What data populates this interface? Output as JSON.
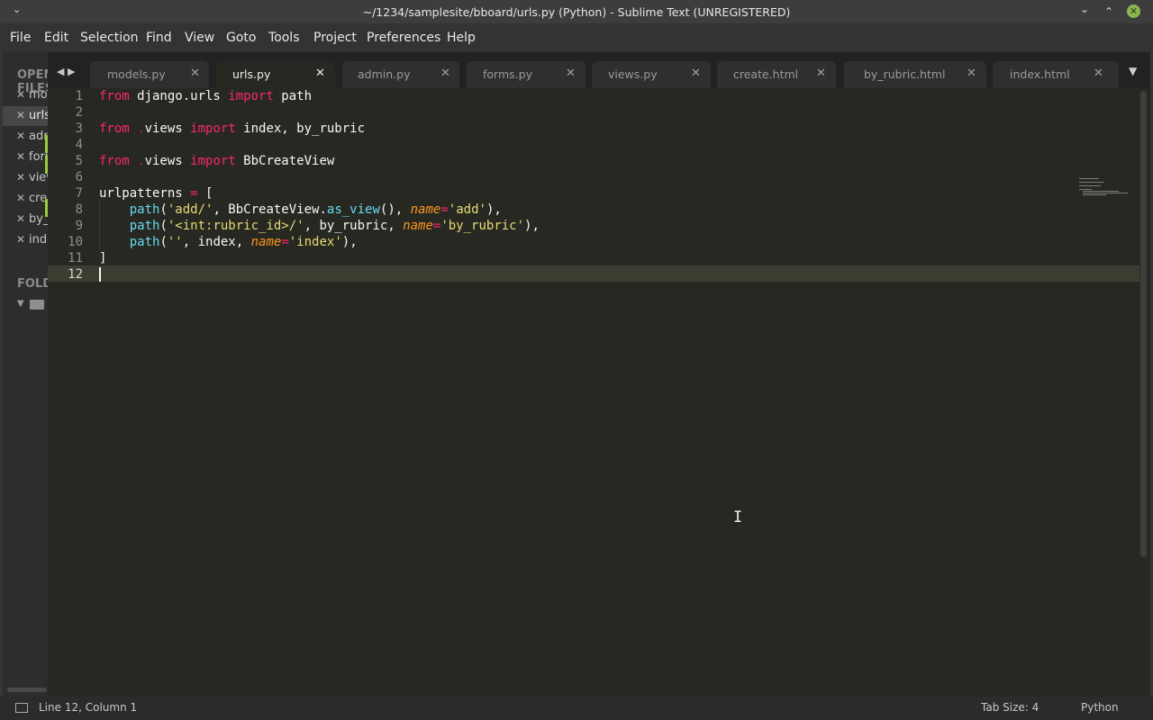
{
  "window": {
    "title": "~/1234/samplesite/bboard/urls.py (Python) - Sublime Text (UNREGISTERED)",
    "menu_arrow": "⌄",
    "minimize": "⌄",
    "maximize": "⌃",
    "close": "✕"
  },
  "menu": [
    "File",
    "Edit",
    "Selection",
    "Find",
    "View",
    "Goto",
    "Tools",
    "Project",
    "Preferences",
    "Help"
  ],
  "sidebar": {
    "open_files_header": "OPEN FILES",
    "folders_header": "FOLDERS",
    "files": [
      {
        "name": "models.py",
        "modified": false,
        "active": false
      },
      {
        "name": "urls.py",
        "modified": false,
        "active": true
      },
      {
        "name": "admin.py",
        "modified": true,
        "active": false
      },
      {
        "name": "forms.py",
        "modified": true,
        "active": false
      },
      {
        "name": "views.py",
        "modified": false,
        "active": false
      },
      {
        "name": "create.html",
        "modified": true,
        "active": false
      },
      {
        "name": "by_rubric.html",
        "modified": false,
        "active": false
      },
      {
        "name": "index.html",
        "modified": false,
        "active": false
      }
    ]
  },
  "tabs": [
    {
      "label": "models.py",
      "active": false
    },
    {
      "label": "urls.py",
      "active": true
    },
    {
      "label": "admin.py",
      "active": false
    },
    {
      "label": "forms.py",
      "active": false
    },
    {
      "label": "views.py",
      "active": false
    },
    {
      "label": "create.html",
      "active": false
    },
    {
      "label": "by_rubric.html",
      "active": false
    },
    {
      "label": "index.html",
      "active": false
    }
  ],
  "editor": {
    "line_numbers": [
      "1",
      "2",
      "3",
      "4",
      "5",
      "6",
      "7",
      "8",
      "9",
      "10",
      "11",
      "12"
    ],
    "current_line": 12,
    "code": {
      "l1": {
        "kw_from": "from",
        "mod": " django.urls ",
        "kw_import": "import",
        "name": " path"
      },
      "l3": {
        "kw_from": "from",
        "dot": " .",
        "mod": "views ",
        "kw_import": "import",
        "names": " index, by_rubric"
      },
      "l5": {
        "kw_from": "from",
        "dot": " .",
        "mod": "views ",
        "kw_import": "import",
        "names": " BbCreateView"
      },
      "l7": {
        "var": "urlpatterns ",
        "eq": "=",
        "bracket": " ["
      },
      "l8": {
        "indent": "    ",
        "fn": "path",
        "p1": "(",
        "s1": "'add/'",
        "p2": ", BbCreateView.",
        "m": "as_view",
        "p3": "(), ",
        "kw": "name",
        "eq": "=",
        "s2": "'add'",
        "p4": "),"
      },
      "l9": {
        "indent": "    ",
        "fn": "path",
        "p1": "(",
        "s1": "'<int:rubric_id>/'",
        "p2": ", by_rubric, ",
        "kw": "name",
        "eq": "=",
        "s2": "'by_rubric'",
        "p4": "),"
      },
      "l10": {
        "indent": "    ",
        "fn": "path",
        "p1": "(",
        "s1": "''",
        "p2": ", index, ",
        "kw": "name",
        "eq": "=",
        "s2": "'index'",
        "p4": "),"
      },
      "l11": {
        "bracket": "]"
      }
    }
  },
  "status": {
    "position": "Line 12, Column 1",
    "tab_size": "Tab Size: 4",
    "syntax": "Python"
  },
  "colors": {
    "background": "#272822",
    "keyword": "#f92672",
    "function": "#66d9ef",
    "string": "#e6db74",
    "parameter": "#fd971f",
    "modified_marker": "#9bcb3e"
  }
}
